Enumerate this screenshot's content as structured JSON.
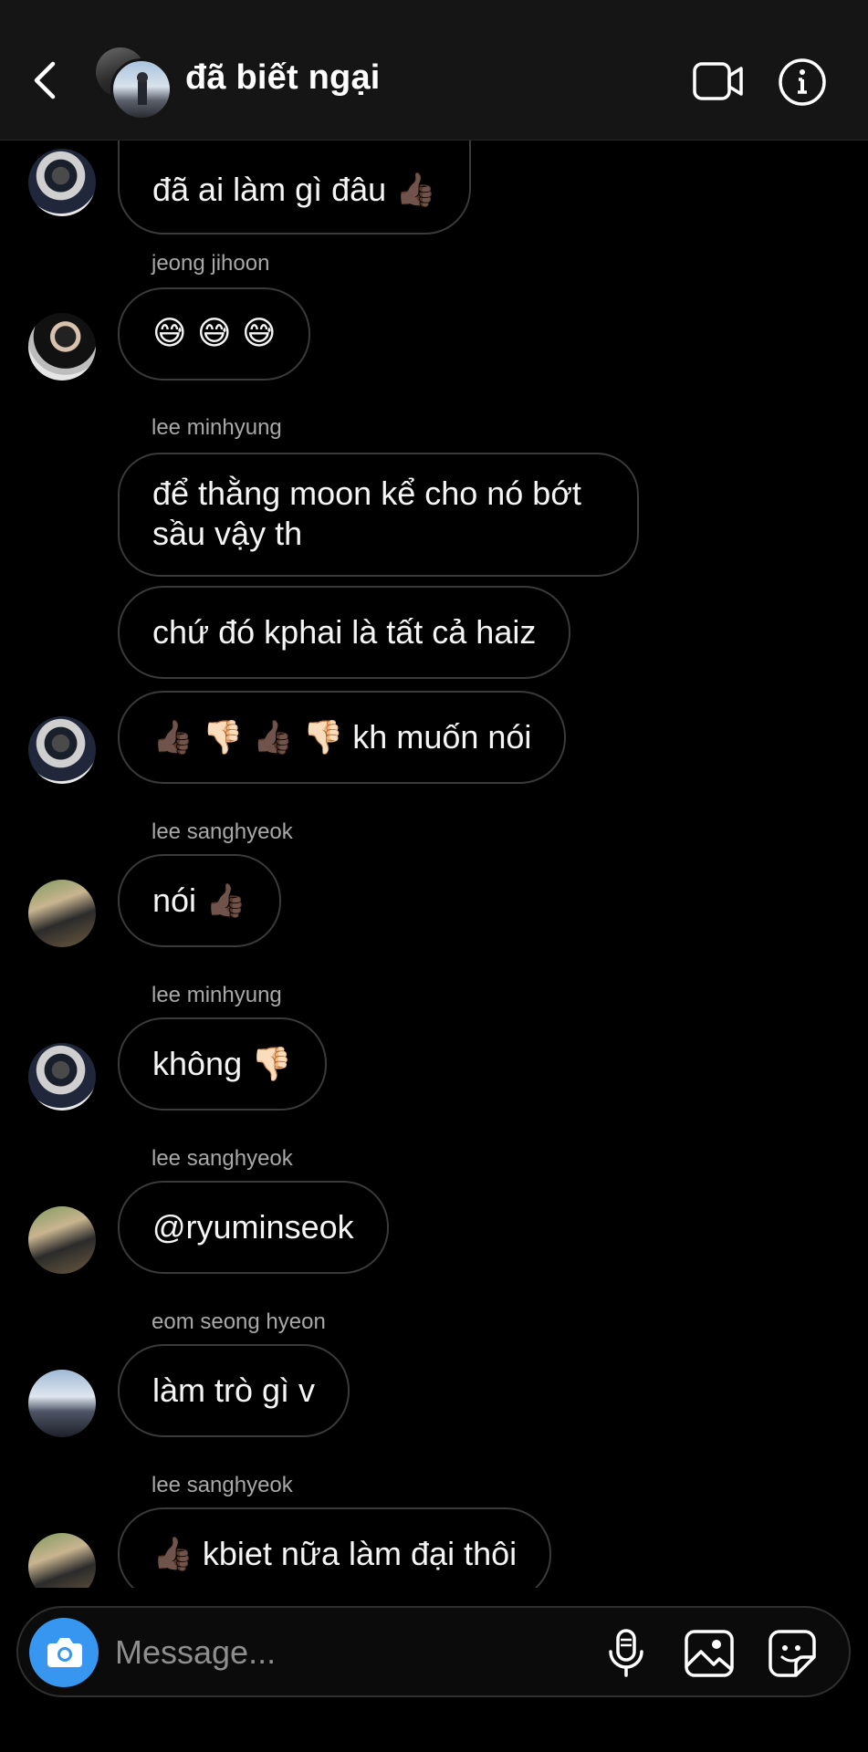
{
  "header": {
    "title": "đã biết ngại"
  },
  "messages": [
    {
      "sender": "",
      "text": "đã ai làm gì đâu 👍🏿"
    },
    {
      "sender": "jeong jihoon",
      "text": "😅 😅 😅"
    },
    {
      "sender": "lee minhyung",
      "text": "để thằng moon kể cho nó bớt sầu vậy th"
    },
    {
      "sender": "",
      "text": "chứ đó kphai là tất cả haiz"
    },
    {
      "sender": "",
      "text": "👍🏿 👎🏻 👍🏿 👎🏻 kh muốn nói"
    },
    {
      "sender": "lee sanghyeok",
      "text": "nói 👍🏿"
    },
    {
      "sender": "lee minhyung",
      "text": "không 👎🏻"
    },
    {
      "sender": "lee sanghyeok",
      "text": "@ryuminseok"
    },
    {
      "sender": "eom seong hyeon",
      "text": "làm trò gì v"
    },
    {
      "sender": "lee sanghyeok",
      "text": "👍🏿 kbiet nữa làm đại thôi"
    }
  ],
  "composer": {
    "placeholder": "Message..."
  },
  "icons": {
    "back": "chevron-left-icon",
    "video": "video-camera-icon",
    "info": "info-icon",
    "camera": "camera-icon",
    "mic": "microphone-icon",
    "gallery": "image-icon",
    "sticker": "sticker-icon"
  },
  "colors": {
    "background": "#000000",
    "header": "#151515",
    "bubble_border": "#3a3a3a",
    "accent": "#3797f0",
    "secondary_text": "#a8a8a8"
  }
}
